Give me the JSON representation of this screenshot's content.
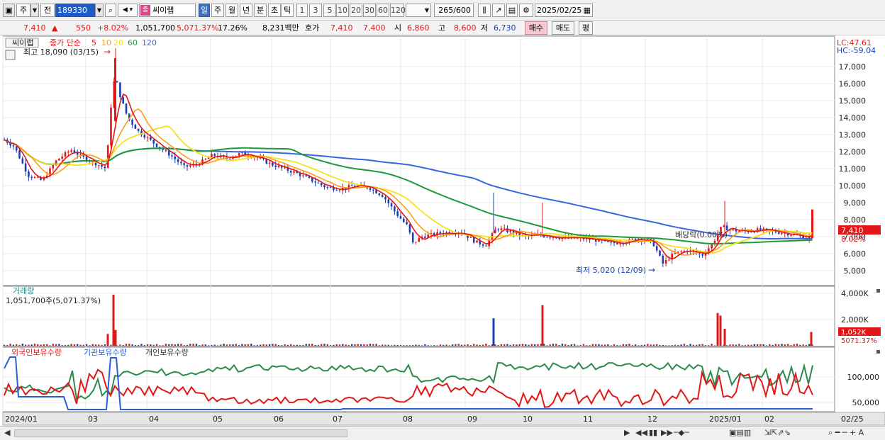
{
  "toolbar": {
    "period": "주",
    "view": "전",
    "code": "189330",
    "stock_name": "씨이랩",
    "stock_badge": "증",
    "periods": [
      "일",
      "주",
      "월",
      "년",
      "분",
      "초",
      "틱"
    ],
    "intervals": [
      "1",
      "3",
      "5",
      "10",
      "20",
      "30",
      "60",
      "120"
    ],
    "count": "265",
    "count_total": "/600",
    "date": "2025/02/25"
  },
  "quote": {
    "price": "7,410",
    "change_sign": "▲",
    "change": "550",
    "change_pct": "+8.02%",
    "volume": "1,051,700",
    "volume_pct": "5,071.37%",
    "turnover_rate": "17.26%",
    "amount": "8,231백만",
    "ask_label": "호가",
    "ask": "7,410",
    "bid": "7,400",
    "open_label": "시",
    "open": "6,860",
    "high_label": "고",
    "high": "8,600",
    "low_label": "저",
    "low": "6,730",
    "buy_button": "매수",
    "sell_button": "매도",
    "eval_button": "평"
  },
  "price_panel": {
    "name": "씨이랩",
    "indicator": "종가 단순",
    "ma_labels": [
      "5",
      "10",
      "20",
      "60",
      "120"
    ],
    "high_marker": "최고 18,090 (03/15)",
    "low_marker": "최저 5,020 (12/09)",
    "dividend": "배당락(0.00%)",
    "lc": "LC:47.61",
    "hc": "HC:-59.04",
    "last_price": "7,410",
    "last_pct": "8.02%",
    "y_ticks": [
      "17,000",
      "16,000",
      "15,000",
      "14,000",
      "13,000",
      "12,000",
      "11,000",
      "10,000",
      "9,000",
      "8,000",
      "7,000",
      "6,000",
      "5,000"
    ]
  },
  "volume_panel": {
    "title": "거래량",
    "value": "1,051,700주(5,071.37%)",
    "y_ticks": [
      "4,000K",
      "2,000K"
    ],
    "last_volume": "1,052K",
    "last_pct": "5071.37%"
  },
  "holdings_panel": {
    "series": [
      "외국인보유수량",
      "기관보유수량",
      "개인보유수량"
    ],
    "y_ticks": [
      "100,000",
      "50,000"
    ]
  },
  "x_axis": [
    "2024/01",
    "03",
    "04",
    "05",
    "06",
    "07",
    "08",
    "09",
    "10",
    "11",
    "12",
    "2025/01",
    "02"
  ],
  "x_axis_right": "02/25",
  "colors": {
    "up": "#e21818",
    "down": "#1a3fb8",
    "ma5": "#e21818",
    "ma10": "#ff9d1a",
    "ma20": "#f5e21a",
    "ma60": "#1e9a3a",
    "ma120": "#3a66e0",
    "foreign": "#e21818",
    "institution": "#2a5ed8",
    "individual": "#2c8a4c"
  }
}
